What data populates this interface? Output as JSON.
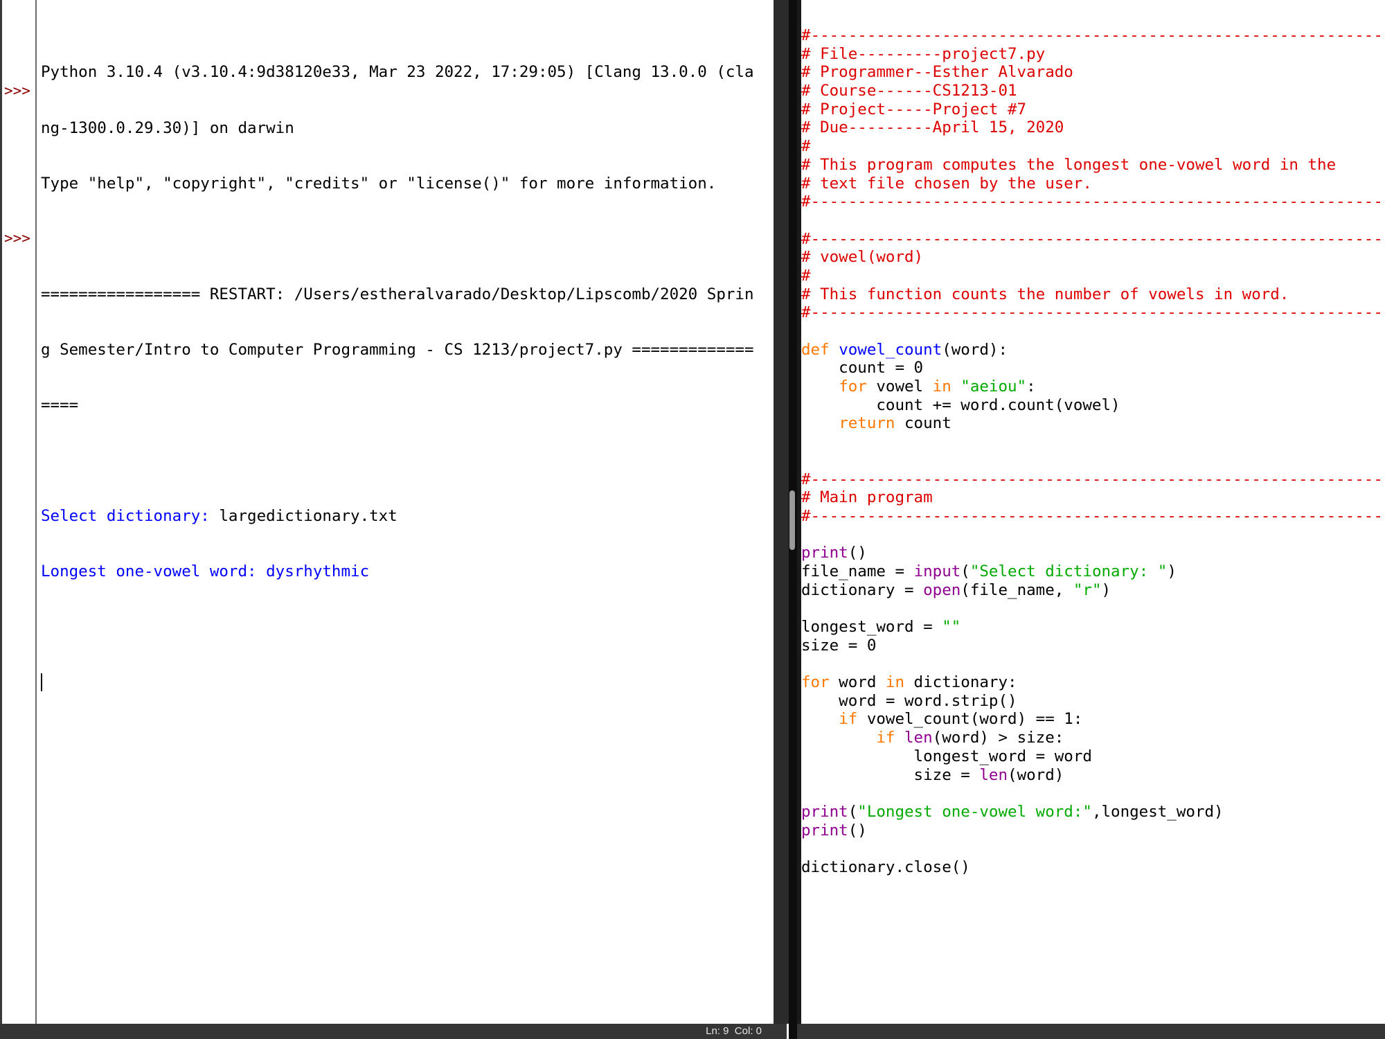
{
  "shell": {
    "prompt": ">>>",
    "lines": [
      {
        "text": "Python 3.10.4 (v3.10.4:9d38120e33, Mar 23 2022, 17:29:05) [Clang 13.0.0 (cla"
      },
      {
        "text": "ng-1300.0.29.30)] on darwin"
      },
      {
        "text": "Type \"help\", \"copyright\", \"credits\" or \"license()\" for more information."
      },
      {
        "text": ""
      },
      {
        "text": "================= RESTART: /Users/estheralvarado/Desktop/Lipscomb/2020 Sprin"
      },
      {
        "text": "g Semester/Intro to Computer Programming - CS 1213/project7.py ============="
      },
      {
        "text": "===="
      },
      {
        "text": ""
      },
      {
        "label": "Select dictionary: ",
        "value": "largedictionary.txt"
      },
      {
        "label": "Longest one-vowel word: ",
        "value": "dysrhythmic"
      }
    ]
  },
  "statusbar": {
    "position": "Ln: 9  Col: 0"
  },
  "editor": {
    "lines": [
      [
        [
          "cmt",
          "#--------------------------------------------------------------------"
        ]
      ],
      [
        [
          "cmt",
          "# File---------project7.py"
        ]
      ],
      [
        [
          "cmt",
          "# Programmer--Esther Alvarado"
        ]
      ],
      [
        [
          "cmt",
          "# Course------CS1213-01"
        ]
      ],
      [
        [
          "cmt",
          "# Project-----Project #7"
        ]
      ],
      [
        [
          "cmt",
          "# Due---------April 15, 2020"
        ]
      ],
      [
        [
          "cmt",
          "#"
        ]
      ],
      [
        [
          "cmt",
          "# This program computes the longest one-vowel word in the"
        ]
      ],
      [
        [
          "cmt",
          "# text file chosen by the user."
        ]
      ],
      [
        [
          "cmt",
          "#--------------------------------------------------------------------"
        ]
      ],
      [],
      [
        [
          "cmt",
          "#--------------------------------------------------------------------"
        ]
      ],
      [
        [
          "cmt",
          "# vowel(word)"
        ]
      ],
      [
        [
          "cmt",
          "#"
        ]
      ],
      [
        [
          "cmt",
          "# This function counts the number of vowels in word."
        ]
      ],
      [
        [
          "cmt",
          "#--------------------------------------------------------------------"
        ]
      ],
      [],
      [
        [
          "kw",
          "def "
        ],
        [
          "def",
          "vowel_count"
        ],
        [
          "txt",
          "(word):"
        ]
      ],
      [
        [
          "txt",
          "    count = 0"
        ]
      ],
      [
        [
          "txt",
          "    "
        ],
        [
          "kw",
          "for"
        ],
        [
          "txt",
          " vowel "
        ],
        [
          "kw",
          "in"
        ],
        [
          "txt",
          " "
        ],
        [
          "str",
          "\"aeiou\""
        ],
        [
          "txt",
          ":"
        ]
      ],
      [
        [
          "txt",
          "        count += word.count(vowel)"
        ]
      ],
      [
        [
          "txt",
          "    "
        ],
        [
          "kw",
          "return"
        ],
        [
          "txt",
          " count"
        ]
      ],
      [],
      [],
      [
        [
          "cmt",
          "#--------------------------------------------------------------------"
        ]
      ],
      [
        [
          "cmt",
          "# Main program"
        ]
      ],
      [
        [
          "cmt",
          "#--------------------------------------------------------------------"
        ]
      ],
      [],
      [
        [
          "bi",
          "print"
        ],
        [
          "txt",
          "()"
        ]
      ],
      [
        [
          "txt",
          "file_name = "
        ],
        [
          "bi",
          "input"
        ],
        [
          "txt",
          "("
        ],
        [
          "str",
          "\"Select dictionary: \""
        ],
        [
          "txt",
          ")"
        ]
      ],
      [
        [
          "txt",
          "dictionary = "
        ],
        [
          "bi",
          "open"
        ],
        [
          "txt",
          "(file_name, "
        ],
        [
          "str",
          "\"r\""
        ],
        [
          "txt",
          ")"
        ]
      ],
      [],
      [
        [
          "txt",
          "longest_word = "
        ],
        [
          "str",
          "\"\""
        ]
      ],
      [
        [
          "txt",
          "size = 0"
        ]
      ],
      [],
      [
        [
          "kw",
          "for"
        ],
        [
          "txt",
          " word "
        ],
        [
          "kw",
          "in"
        ],
        [
          "txt",
          " dictionary:"
        ]
      ],
      [
        [
          "txt",
          "    word = word.strip()"
        ]
      ],
      [
        [
          "txt",
          "    "
        ],
        [
          "kw",
          "if"
        ],
        [
          "txt",
          " vowel_count(word) == 1:"
        ]
      ],
      [
        [
          "txt",
          "        "
        ],
        [
          "kw",
          "if"
        ],
        [
          "txt",
          " "
        ],
        [
          "bi",
          "len"
        ],
        [
          "txt",
          "(word) > size:"
        ]
      ],
      [
        [
          "txt",
          "            longest_word = word"
        ]
      ],
      [
        [
          "txt",
          "            size = "
        ],
        [
          "bi",
          "len"
        ],
        [
          "txt",
          "(word)"
        ]
      ],
      [],
      [
        [
          "bi",
          "print"
        ],
        [
          "txt",
          "("
        ],
        [
          "str",
          "\"Longest one-vowel word:\""
        ],
        [
          "txt",
          ",longest_word)"
        ]
      ],
      [
        [
          "bi",
          "print"
        ],
        [
          "txt",
          "()"
        ]
      ],
      [],
      [
        [
          "txt",
          "dictionary.close()"
        ]
      ]
    ]
  },
  "colors": {
    "comment": "#dd0000",
    "keyword": "#ff7700",
    "definition": "#0000ff",
    "string": "#00aa00",
    "builtin": "#900090",
    "prompt": "#8b0000",
    "shell_output": "#0000ff"
  }
}
